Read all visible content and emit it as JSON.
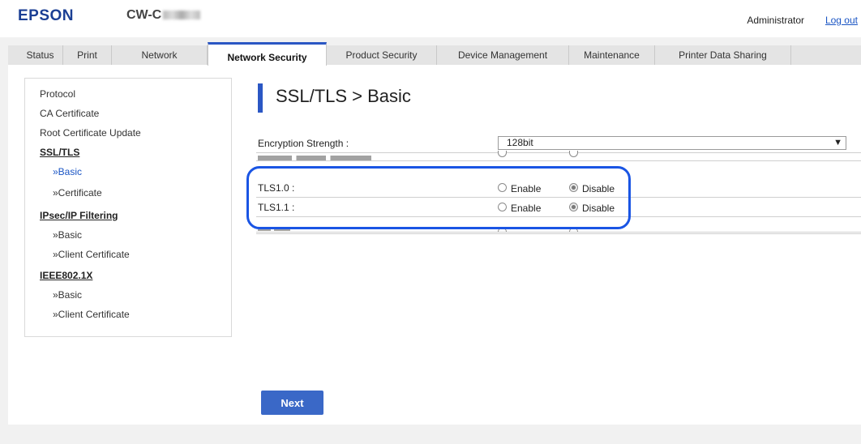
{
  "header": {
    "brand": "EPSON",
    "model": "CW-C",
    "user_label": "Administrator",
    "logout_label": "Log out"
  },
  "tabs": [
    {
      "label": "Status"
    },
    {
      "label": "Print"
    },
    {
      "label": "Network"
    },
    {
      "label": "Network Security",
      "active": true
    },
    {
      "label": "Product Security"
    },
    {
      "label": "Device Management"
    },
    {
      "label": "Maintenance"
    },
    {
      "label": "Printer Data Sharing"
    }
  ],
  "sidebar": {
    "protocol": "Protocol",
    "ca_certificate": "CA Certificate",
    "root_certificate_update": "Root Certificate Update",
    "ssl_tls": "SSL/TLS",
    "ssl_basic": "»Basic",
    "ssl_certificate": "»Certificate",
    "ipsec": "IPsec/IP Filtering",
    "ipsec_basic": "»Basic",
    "ipsec_client_cert": "»Client Certificate",
    "ieee": "IEEE802.1X",
    "ieee_basic": "»Basic",
    "ieee_client_cert": "»Client Certificate"
  },
  "main": {
    "title": "SSL/TLS > Basic",
    "encryption_label": "Encryption Strength :",
    "encryption_value": "128bit",
    "tls10_label": "TLS1.0 :",
    "tls11_label": "TLS1.1 :",
    "enable_label": "Enable",
    "disable_label": "Disable",
    "tls10_selected": "Disable",
    "tls11_selected": "Disable",
    "next_label": "Next"
  },
  "colors": {
    "accent": "#2b57c4",
    "brand": "#1b3f94",
    "highlight": "#1a55e4"
  }
}
